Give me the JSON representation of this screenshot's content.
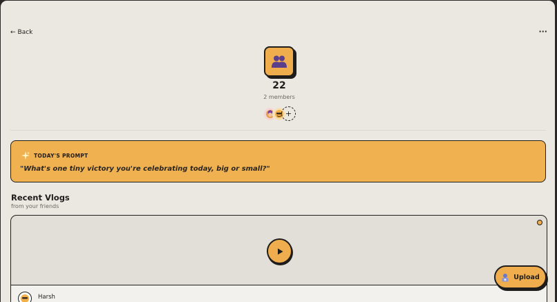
{
  "nav": {
    "back_arrow": "←",
    "back_label": "Back",
    "more_label": "···"
  },
  "group": {
    "icon": "people-icon",
    "name": "22",
    "member_count": "2 members",
    "add_member_label": "+"
  },
  "prompt": {
    "icon": "sparkle-icon",
    "heading": "TODAY'S PROMPT",
    "text": "\"What's one tiny victory you're celebrating today, big or small?\""
  },
  "recent": {
    "title": "Recent Vlogs",
    "subtitle": "from your friends"
  },
  "vlogs": [
    {
      "author": "Harsh",
      "play_icon": "play-icon"
    }
  ],
  "upload": {
    "label": "Upload",
    "icon": "upload-icon"
  },
  "colors": {
    "background": "#ebe8e2",
    "accent": "#f0ad4e",
    "ink": "#1f1d1b",
    "muted": "#6a6660"
  }
}
